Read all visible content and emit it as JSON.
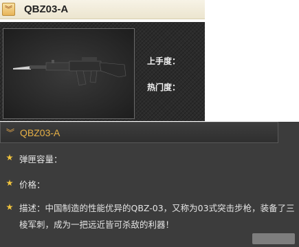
{
  "header": {
    "title": "QBZ03-A",
    "collapse_icon": "double-chevron-down-icon"
  },
  "preview": {
    "ease_label": "上手度：",
    "popularity_label": "热门度："
  },
  "detail": {
    "title": "QBZ03-A",
    "rows": [
      {
        "text": "弹匣容量："
      },
      {
        "text": "价格："
      },
      {
        "text": "描述：中国制造的性能优异的QBZ-03，又称为03式突击步枪，装备了三棱军刺，成为一把远近皆可杀敌的利器！"
      }
    ]
  },
  "colors": {
    "header_bg": "#ece5cf",
    "panel_bg": "#3c3c3c",
    "accent": "#e6b046",
    "bullet": "#f2c53d"
  }
}
